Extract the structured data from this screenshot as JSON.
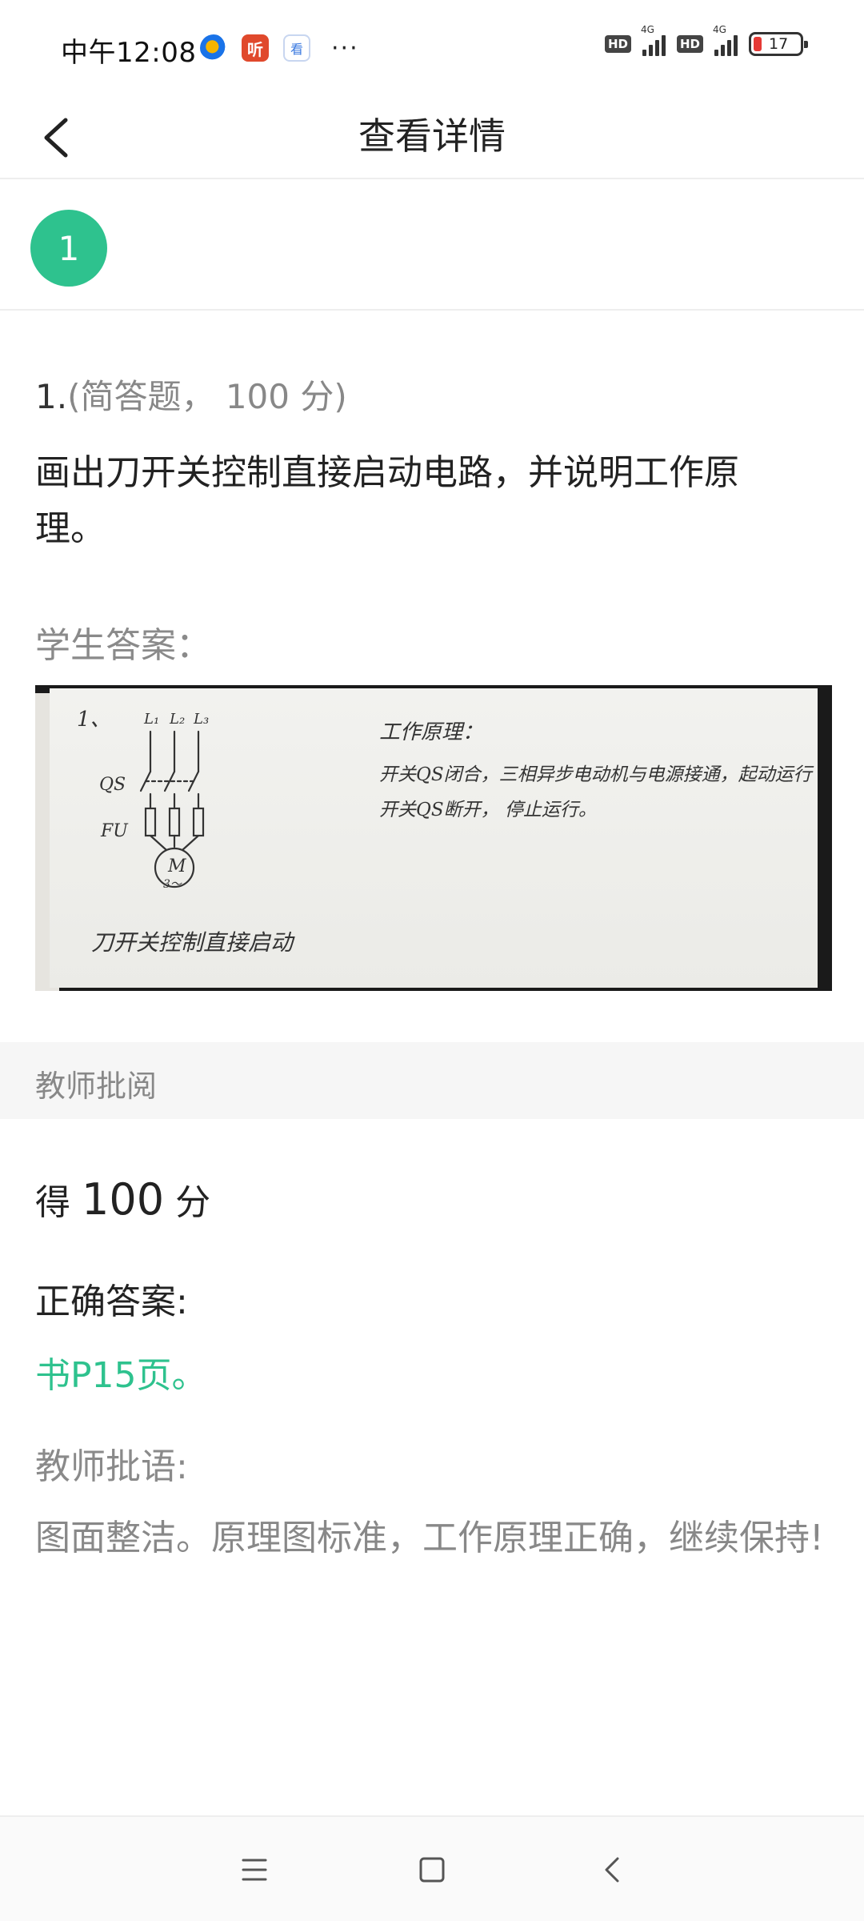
{
  "status_bar": {
    "time": "中午12:08",
    "app_icons": [
      {
        "name": "browser-app-icon",
        "glyph": ""
      },
      {
        "name": "ting-app-icon",
        "glyph": "听"
      },
      {
        "name": "video-app-icon",
        "glyph": "看"
      }
    ],
    "more": "···",
    "hd_label": "HD",
    "network_label": "4G",
    "battery": "17",
    "battery_level": 0.17
  },
  "header": {
    "title": "查看详情",
    "back_icon": "chevron-left-icon"
  },
  "question_nav": {
    "current": "1",
    "active_color": "#2ec28e"
  },
  "question": {
    "number": "1.",
    "meta": "(简答题， 100 分)",
    "text": "画出刀开关控制直接启动电路，并说明工作原理。"
  },
  "student_answer": {
    "label": "学生答案：",
    "photo": {
      "item_no": "1、",
      "phase_labels": [
        "L₁",
        "L₂",
        "L₃"
      ],
      "qs_label": "QS",
      "fu_label": "FU",
      "motor_label": "M",
      "motor_sub": "3～",
      "caption": "刀开关控制直接启动",
      "principle_title": "工作原理：",
      "principle_line1": "开关QS闭合，三相异步电动机与电源接通，起动运行",
      "principle_line2": "开关QS断开，  停止运行。"
    }
  },
  "review": {
    "section_label": "教师批阅",
    "score_prefix": "得",
    "score_value": "100",
    "score_suffix": "分",
    "correct_label": "正确答案:",
    "correct_answer": "书P15页。",
    "correct_color": "#2ec28e",
    "comment_label": "教师批语:",
    "comment": "图面整洁。原理图标准，工作原理正确，继续保持!"
  },
  "system_nav": {
    "menu_icon": "menu-icon",
    "home_icon": "home-square-icon",
    "back_icon": "back-triangle-icon"
  }
}
